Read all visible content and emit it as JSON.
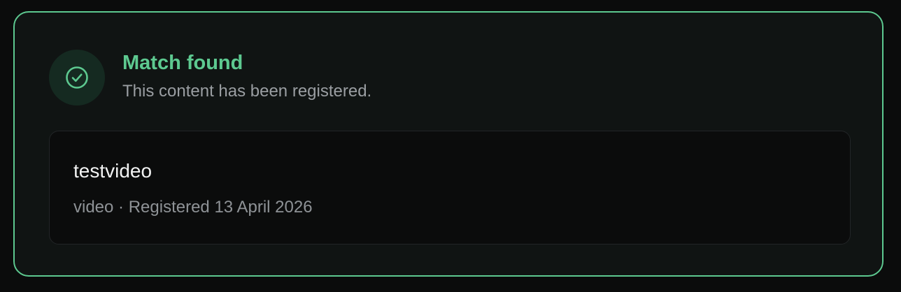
{
  "status": {
    "title": "Match found",
    "message": "This content has been registered.",
    "icon": "check-circle-icon",
    "accent_color": "#5dc990"
  },
  "item": {
    "name": "testvideo",
    "type": "video",
    "separator": "·",
    "registered_label": "Registered",
    "registered_date": "13 April 2026"
  }
}
